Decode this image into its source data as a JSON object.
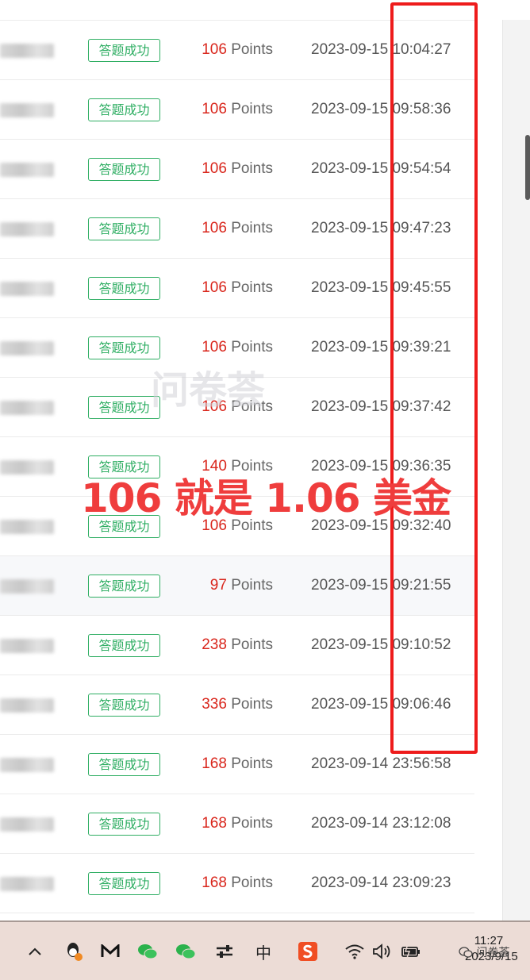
{
  "status_label": "答题成功",
  "points_unit": "Points",
  "records": [
    {
      "points": "106",
      "time": "2023-09-15 10:04:27"
    },
    {
      "points": "106",
      "time": "2023-09-15 09:58:36"
    },
    {
      "points": "106",
      "time": "2023-09-15 09:54:54"
    },
    {
      "points": "106",
      "time": "2023-09-15 09:47:23"
    },
    {
      "points": "106",
      "time": "2023-09-15 09:45:55"
    },
    {
      "points": "106",
      "time": "2023-09-15 09:39:21"
    },
    {
      "points": "106",
      "time": "2023-09-15 09:37:42"
    },
    {
      "points": "140",
      "time": "2023-09-15 09:36:35"
    },
    {
      "points": "106",
      "time": "2023-09-15 09:32:40"
    },
    {
      "points": "97",
      "time": "2023-09-15 09:21:55"
    },
    {
      "points": "238",
      "time": "2023-09-15 09:10:52"
    },
    {
      "points": "336",
      "time": "2023-09-15 09:06:46"
    },
    {
      "points": "168",
      "time": "2023-09-14 23:56:58"
    },
    {
      "points": "168",
      "time": "2023-09-14 23:12:08"
    },
    {
      "points": "168",
      "time": "2023-09-14 23:09:23"
    }
  ],
  "annotation": "106 就是 1.06 美金",
  "watermark": "问卷荟",
  "taskbar": {
    "ime_label": "中",
    "clock_time": "11:27",
    "clock_date": "2023/9/15",
    "wechat_mark": "问卷荟"
  },
  "colors": {
    "status_green": "#2fae63",
    "points_red": "#d9261c",
    "highlight_box": "#ee1c1c",
    "annotation_red": "#ef3d3d",
    "taskbar_bg": "#ecdcd6"
  },
  "icons": [
    "chevron-up-icon",
    "qq-icon",
    "mail-icon",
    "wechat-icon",
    "wechat-icon",
    "settings-sliders-icon",
    "ime-icon",
    "sogou-icon",
    "wifi-icon",
    "speaker-icon",
    "battery-icon"
  ]
}
